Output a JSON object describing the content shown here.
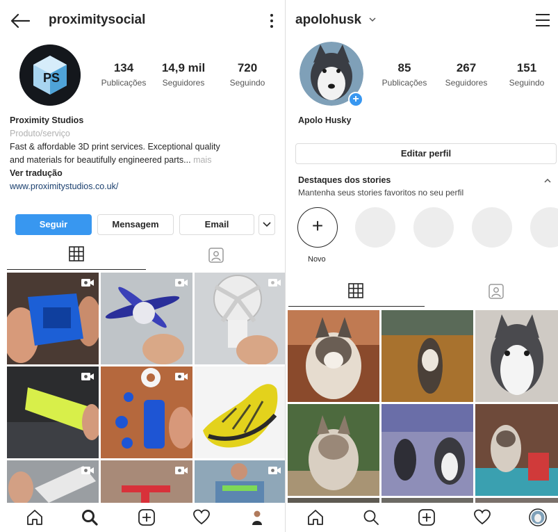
{
  "left_profile": {
    "username": "proximitysocial",
    "stats": [
      {
        "value": "134",
        "label": "Publicações"
      },
      {
        "value": "14,9 mil",
        "label": "Seguidores"
      },
      {
        "value": "720",
        "label": "Seguindo"
      }
    ],
    "bio": {
      "name": "Proximity Studios",
      "category": "Produto/serviço",
      "line1": "Fast & affordable 3D print services. Exceptional quality",
      "line2": "and materials for beautifully engineered parts...",
      "more": "mais",
      "translate": "Ver tradução",
      "website": "www.proximitystudios.co.uk/"
    },
    "buttons": {
      "follow": "Seguir",
      "message": "Mensagem",
      "email": "Email"
    }
  },
  "right_profile": {
    "username": "apolohusk",
    "stats": [
      {
        "value": "85",
        "label": "Publicações"
      },
      {
        "value": "267",
        "label": "Seguidores"
      },
      {
        "value": "151",
        "label": "Seguindo"
      }
    ],
    "name": "Apolo Husky",
    "edit_profile": "Editar perfil",
    "highlights": {
      "title": "Destaques dos stories",
      "subtitle": "Mantenha seus stories favoritos no seu perfil",
      "new_label": "Novo"
    }
  },
  "colors": {
    "accent": "#3897f0",
    "text": "#262626",
    "muted": "#b0b0b0",
    "link": "#1a3f6e"
  },
  "icons": {
    "back": "back-arrow-icon",
    "more": "more-vertical-icon",
    "menu": "hamburger-menu-icon",
    "grid": "grid-icon",
    "tagged": "tagged-photos-icon",
    "video": "video-camera-icon",
    "home": "home-icon",
    "search": "search-icon",
    "add": "add-post-icon",
    "activity": "heart-icon",
    "profile": "profile-icon"
  }
}
